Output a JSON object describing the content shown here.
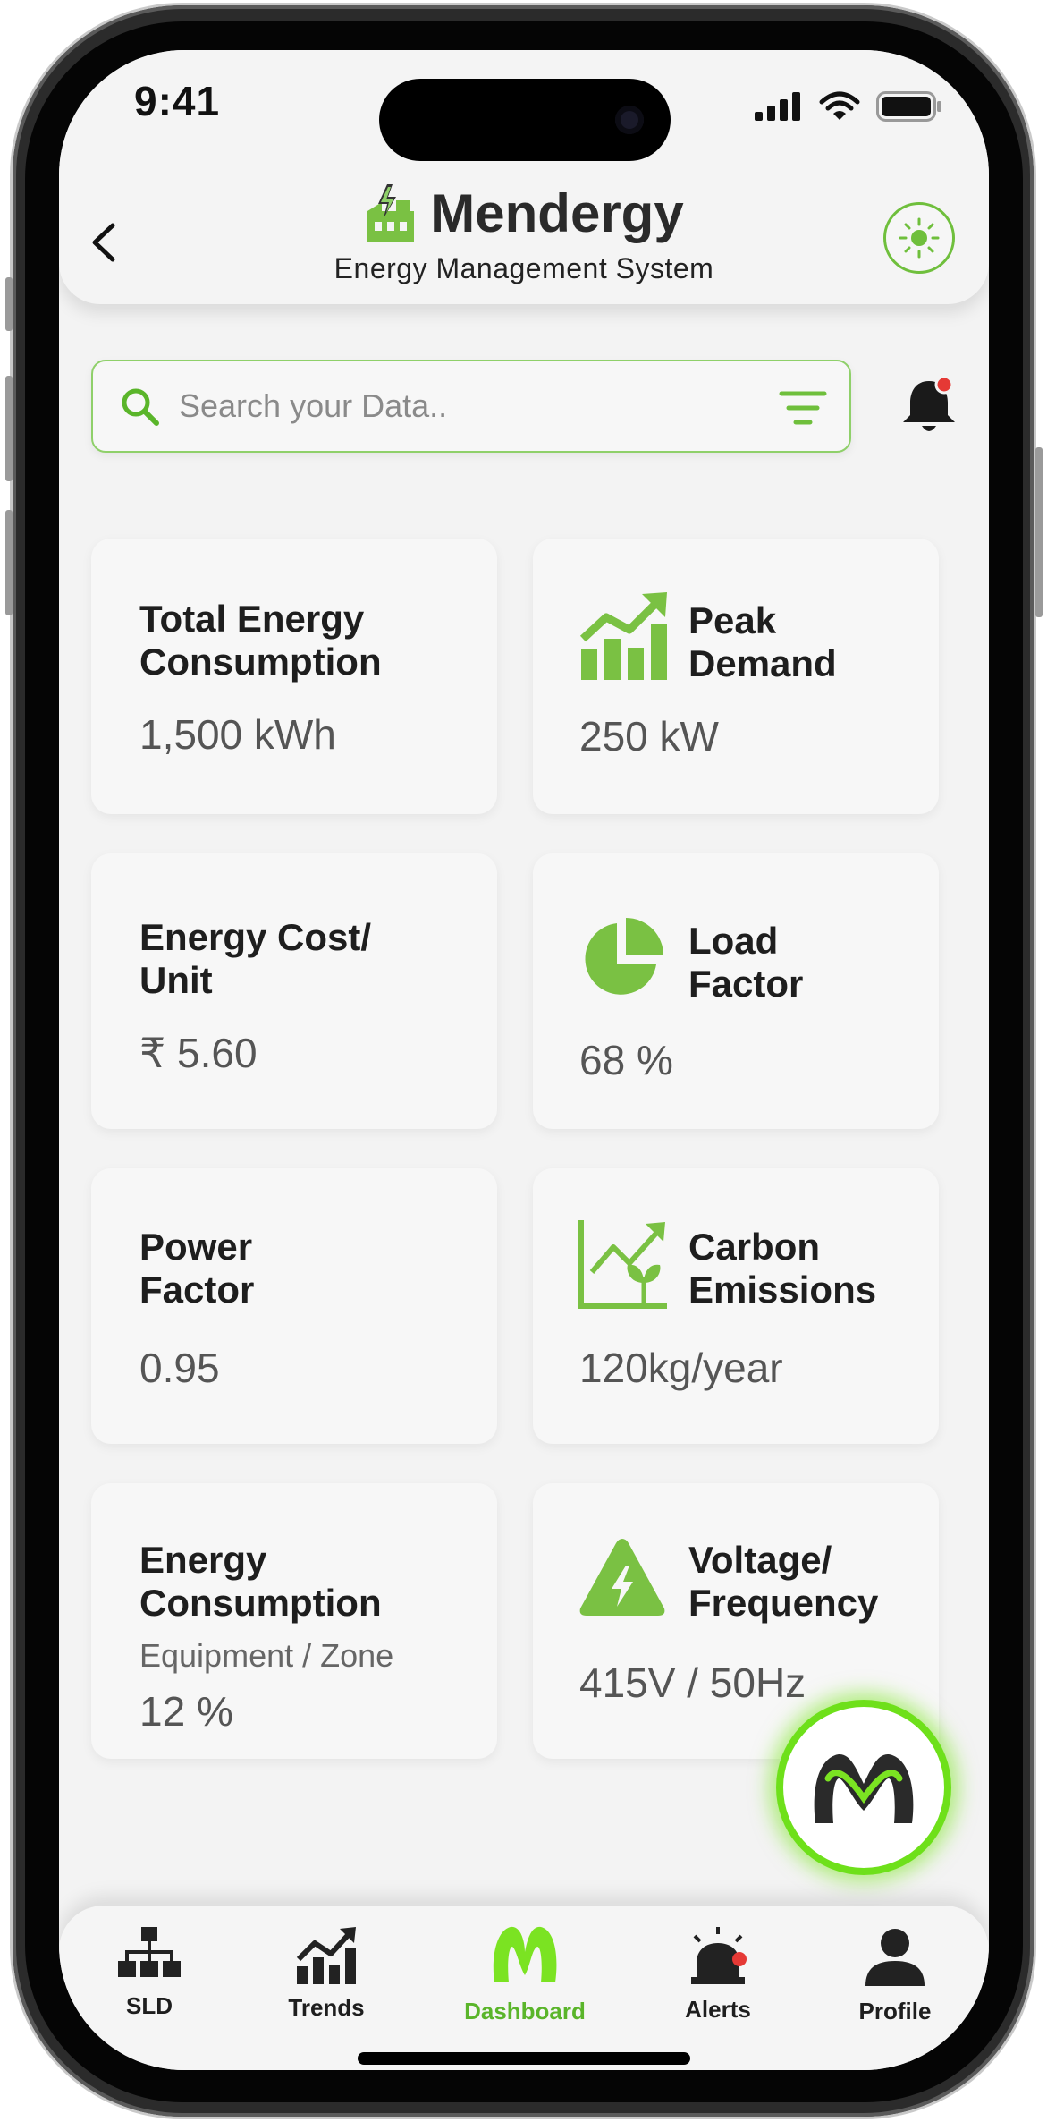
{
  "status_bar": {
    "time": "9:41"
  },
  "header": {
    "title": "Mendergy",
    "subtitle": "Energy Management System",
    "back_icon": "chevron-left-icon",
    "theme_icon": "sun-icon"
  },
  "search": {
    "placeholder": "Search your Data.."
  },
  "cards": [
    {
      "title_line1": "Total Energy",
      "title_line2": "Consumption",
      "value": "1,500 kWh",
      "icon": "none"
    },
    {
      "title_line1": "Peak",
      "title_line2": "Demand",
      "value": "250 kW",
      "icon": "chart-up-icon"
    },
    {
      "title_line1": "Energy Cost/",
      "title_line2": "Unit",
      "value": "₹ 5.60",
      "icon": "none"
    },
    {
      "title_line1": "Load",
      "title_line2": "Factor",
      "value": "68 %",
      "icon": "pie-icon"
    },
    {
      "title_line1": "Power",
      "title_line2": "Factor",
      "value": "0.95",
      "icon": "none"
    },
    {
      "title_line1": "Carbon",
      "title_line2": "Emissions",
      "value": "120kg/year",
      "icon": "eco-chart-icon"
    },
    {
      "title_line1": "Energy",
      "title_line2": "Consumption",
      "subtitle": "Equipment / Zone",
      "value": "12 %",
      "icon": "none"
    },
    {
      "title_line1": "Voltage/",
      "title_line2": "Frequency",
      "value": "415V / 50Hz",
      "icon": "warning-bolt-icon"
    }
  ],
  "bottom_nav": [
    {
      "label": "SLD",
      "icon": "hierarchy-icon"
    },
    {
      "label": "Trends",
      "icon": "trends-icon"
    },
    {
      "label": "Dashboard",
      "icon": "m-logo-icon",
      "active": true
    },
    {
      "label": "Alerts",
      "icon": "siren-icon"
    },
    {
      "label": "Profile",
      "icon": "person-icon"
    }
  ],
  "colors": {
    "accent": "#7ac143",
    "accent_dark": "#5ab52a",
    "background": "#f3f3f3",
    "glow": "#6ee01a"
  }
}
